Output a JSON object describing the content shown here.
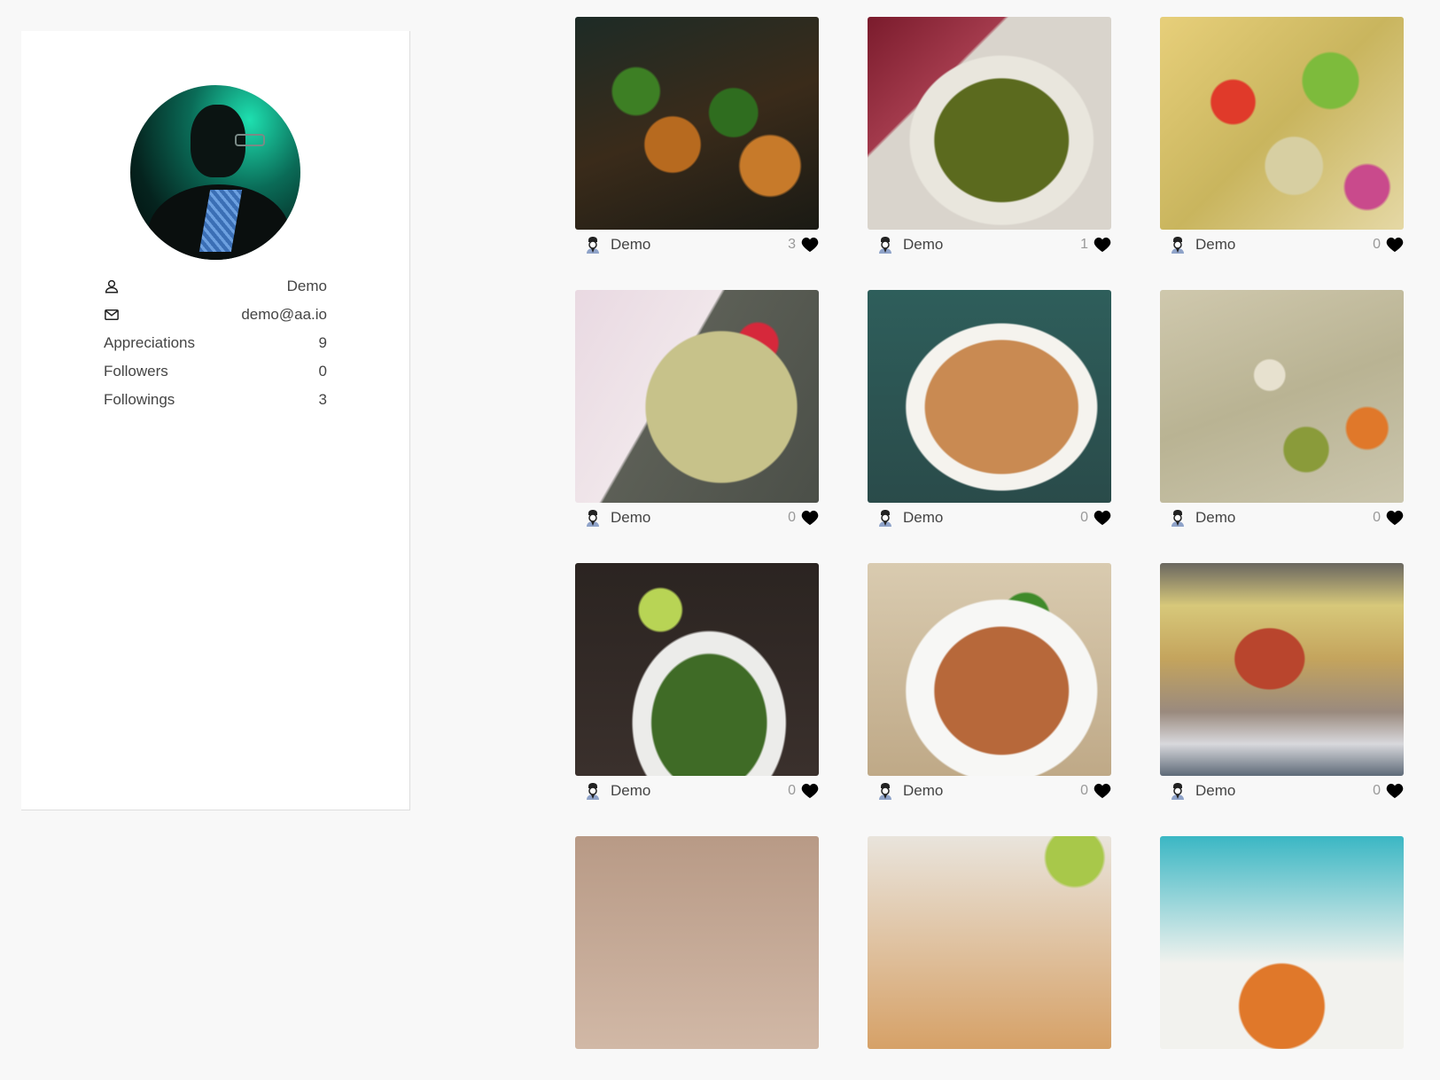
{
  "profile": {
    "username": "Demo",
    "email": "demo@aa.io",
    "stats": [
      {
        "label": "Appreciations",
        "value": "9"
      },
      {
        "label": "Followers",
        "value": "0"
      },
      {
        "label": "Followings",
        "value": "3"
      }
    ]
  },
  "icons": {
    "user": "user-icon",
    "email": "envelope-icon",
    "author": "chef-icon",
    "like": "heart-icon"
  },
  "recipes": [
    {
      "author": "Demo",
      "likes": "3"
    },
    {
      "author": "Demo",
      "likes": "1"
    },
    {
      "author": "Demo",
      "likes": "0"
    },
    {
      "author": "Demo",
      "likes": "0"
    },
    {
      "author": "Demo",
      "likes": "0"
    },
    {
      "author": "Demo",
      "likes": "0"
    },
    {
      "author": "Demo",
      "likes": "0"
    },
    {
      "author": "Demo",
      "likes": "0"
    },
    {
      "author": "Demo",
      "likes": "0"
    },
    {
      "author": "",
      "likes": ""
    },
    {
      "author": "",
      "likes": ""
    },
    {
      "author": "",
      "likes": ""
    }
  ],
  "colors": {
    "page_background": "#f8f8f8",
    "card_background": "#ffffff",
    "text": "#444444",
    "likes_count": "#999999",
    "heart": "#000000"
  }
}
